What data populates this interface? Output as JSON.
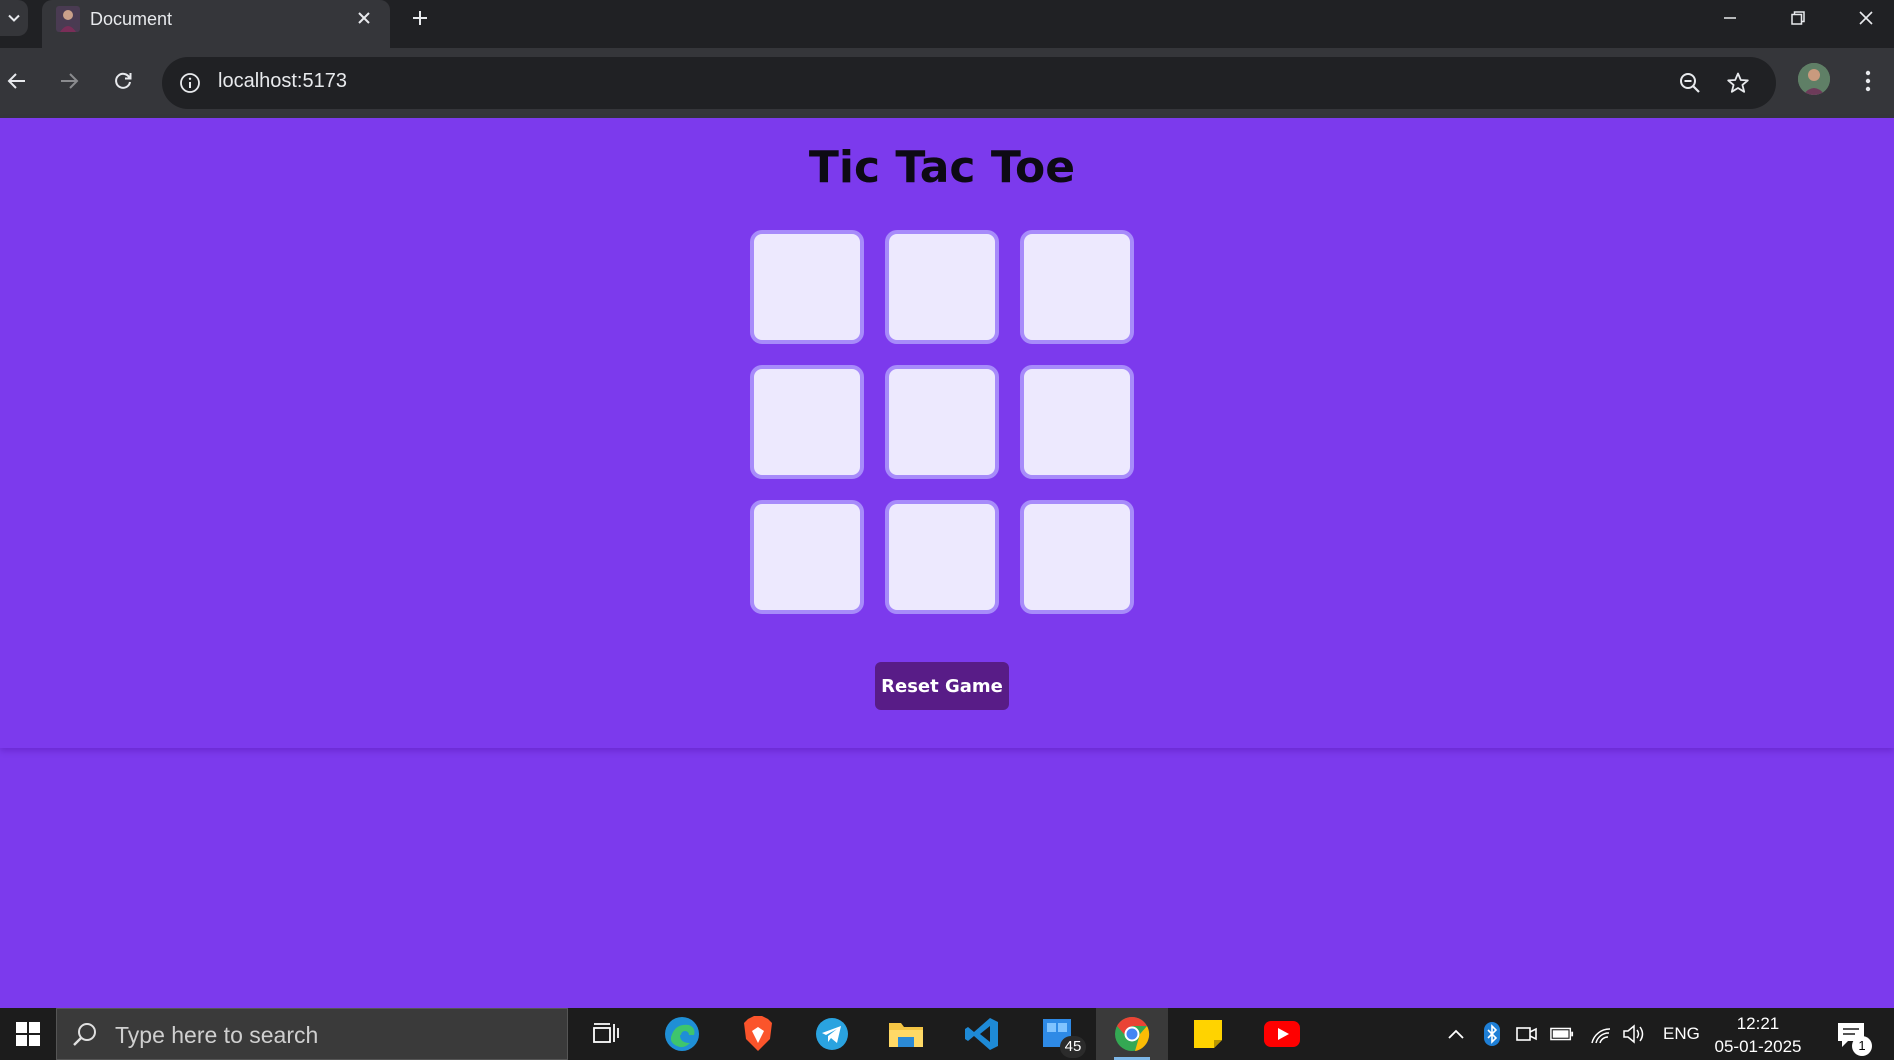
{
  "browser": {
    "tab": {
      "title": "Document"
    },
    "address_bar": {
      "url": "localhost:5173"
    }
  },
  "game": {
    "title": "Tic Tac Toe",
    "board": [
      "",
      "",
      "",
      "",
      "",
      "",
      "",
      "",
      ""
    ],
    "reset_label": "Reset Game"
  },
  "taskbar": {
    "search_placeholder": "Type here to search",
    "apps": [
      "task-view",
      "edge",
      "brave",
      "telegram",
      "file-explorer",
      "vscode",
      "store",
      "chrome",
      "sticky-notes",
      "youtube"
    ],
    "store_badge": "45",
    "tray": {
      "language": "ENG"
    },
    "clock": {
      "time": "12:21",
      "date": "05-01-2025"
    },
    "notification_count": "1"
  },
  "colors": {
    "page_background": "#7c3aed",
    "cell_background": "#ede9fe",
    "cell_border": "#a78bfa",
    "reset_button": "#581c87"
  }
}
